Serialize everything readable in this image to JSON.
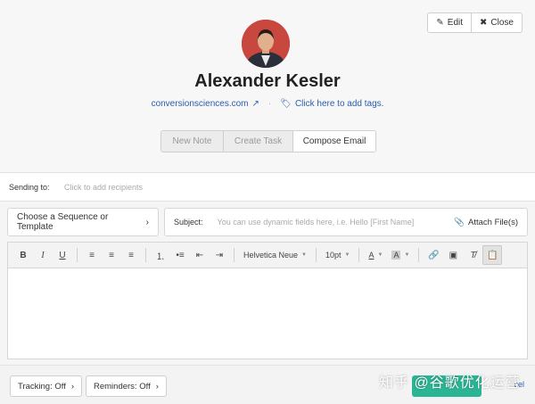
{
  "header": {
    "edit_label": "Edit",
    "close_label": "Close",
    "name": "Alexander Kesler",
    "website": "conversionsciences.com",
    "tags_link": "Click here to add tags.",
    "separator": "·"
  },
  "tabs": [
    {
      "label": "New Note"
    },
    {
      "label": "Create Task"
    },
    {
      "label": "Compose Email"
    }
  ],
  "composer": {
    "sending_label": "Sending to:",
    "sending_placeholder": "Click to add recipients",
    "sequence_label": "Choose a Sequence or Template",
    "subject_label": "Subject:",
    "subject_placeholder": "You can use dynamic fields here, i.e. Hello [First Name]",
    "attach_label": "Attach File(s)"
  },
  "toolbar": {
    "font": "Helvetica Neue",
    "size": "10pt",
    "text_color_label": "A",
    "bg_color_label": "A"
  },
  "footer": {
    "tracking": "Tracking: Off",
    "reminders": "Reminders: Off",
    "cancel": "cel"
  },
  "watermark": "知乎 @谷歌优化运营",
  "colors": {
    "accent": "#2bb594",
    "link": "#2a5db0",
    "avatar_bg": "#c8473f"
  }
}
